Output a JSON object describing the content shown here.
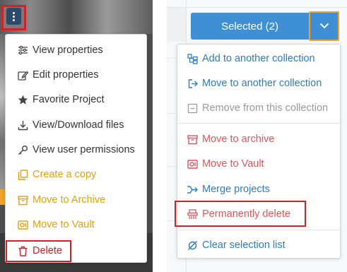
{
  "left_menu": {
    "items": [
      {
        "label": "View properties",
        "icon": "sliders-icon",
        "color": "#333333"
      },
      {
        "label": "Edit properties",
        "icon": "edit-icon",
        "color": "#333333"
      },
      {
        "label": "Favorite Project",
        "icon": "star-icon",
        "color": "#333333"
      },
      {
        "label": "View/Download files",
        "icon": "download-icon",
        "color": "#333333"
      },
      {
        "label": "View user permissions",
        "icon": "key-icon",
        "color": "#333333"
      },
      {
        "label": "Create a copy",
        "icon": "copy-icon",
        "color": "#e5a00d"
      },
      {
        "label": "Move to Archive",
        "icon": "archive-icon",
        "color": "#e5a00d"
      },
      {
        "label": "Move to Vault",
        "icon": "vault-icon",
        "color": "#e5a00d"
      },
      {
        "label": "Delete",
        "icon": "trash-icon",
        "color": "#d0212a"
      }
    ]
  },
  "right_panel": {
    "selected_label": "Selected (2)",
    "dropdown_icon": "chevron-down-icon",
    "menu": {
      "items": [
        {
          "label": "Add to another collection",
          "icon": "add-collection-icon"
        },
        {
          "label": "Move to another collection",
          "icon": "move-collection-icon"
        },
        {
          "label": "Remove from this collection",
          "icon": "remove-square-icon",
          "disabled": true
        },
        {
          "label": "Move to archive",
          "icon": "archive-icon"
        },
        {
          "label": "Move to Vault",
          "icon": "vault-icon"
        },
        {
          "label": "Merge projects",
          "icon": "merge-icon"
        },
        {
          "label": "Permanently delete",
          "icon": "shredder-icon"
        },
        {
          "label": "Clear selection list",
          "icon": "clear-icon"
        }
      ]
    }
  },
  "colors": {
    "accent_blue": "#3f8fd4",
    "link_blue": "#2d7cc1",
    "warning_orange": "#e5a00d",
    "danger_red": "#d0212a",
    "highlight_border": "#d0212a"
  }
}
